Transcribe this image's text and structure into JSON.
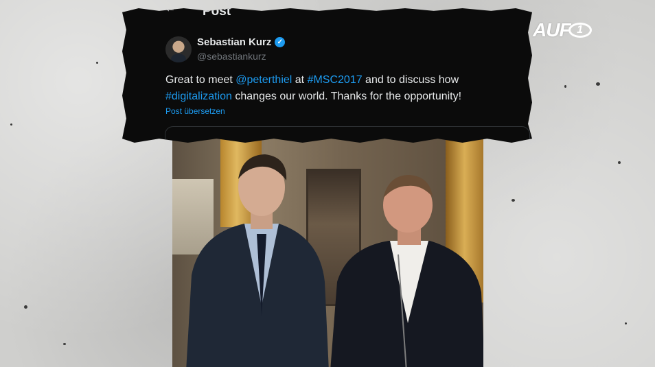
{
  "tweet": {
    "page_title": "Post",
    "author_name": "Sebastian Kurz",
    "author_handle": "@sebastiankurz",
    "text_parts": [
      {
        "text": "Great to meet ",
        "link": false
      },
      {
        "text": "@peterthiel",
        "link": true
      },
      {
        "text": " at ",
        "link": false
      },
      {
        "text": "#MSC2017",
        "link": true
      },
      {
        "text": " and to discuss how ",
        "link": false
      },
      {
        "text": "#digitalization",
        "link": true
      },
      {
        "text": " changes our world. Thanks for the opportunity!",
        "link": false
      }
    ],
    "translate_label": "Post übersetzen",
    "icons": {
      "back": "back-arrow-icon",
      "verified": "verified-badge-icon"
    }
  },
  "logo": {
    "text": "AUF",
    "circle_text": "1"
  },
  "colors": {
    "background": "#0b0b0b",
    "link": "#1d9bf0",
    "text": "#e7e9ea",
    "muted": "#71767b",
    "verified": "#1d9bf0"
  }
}
